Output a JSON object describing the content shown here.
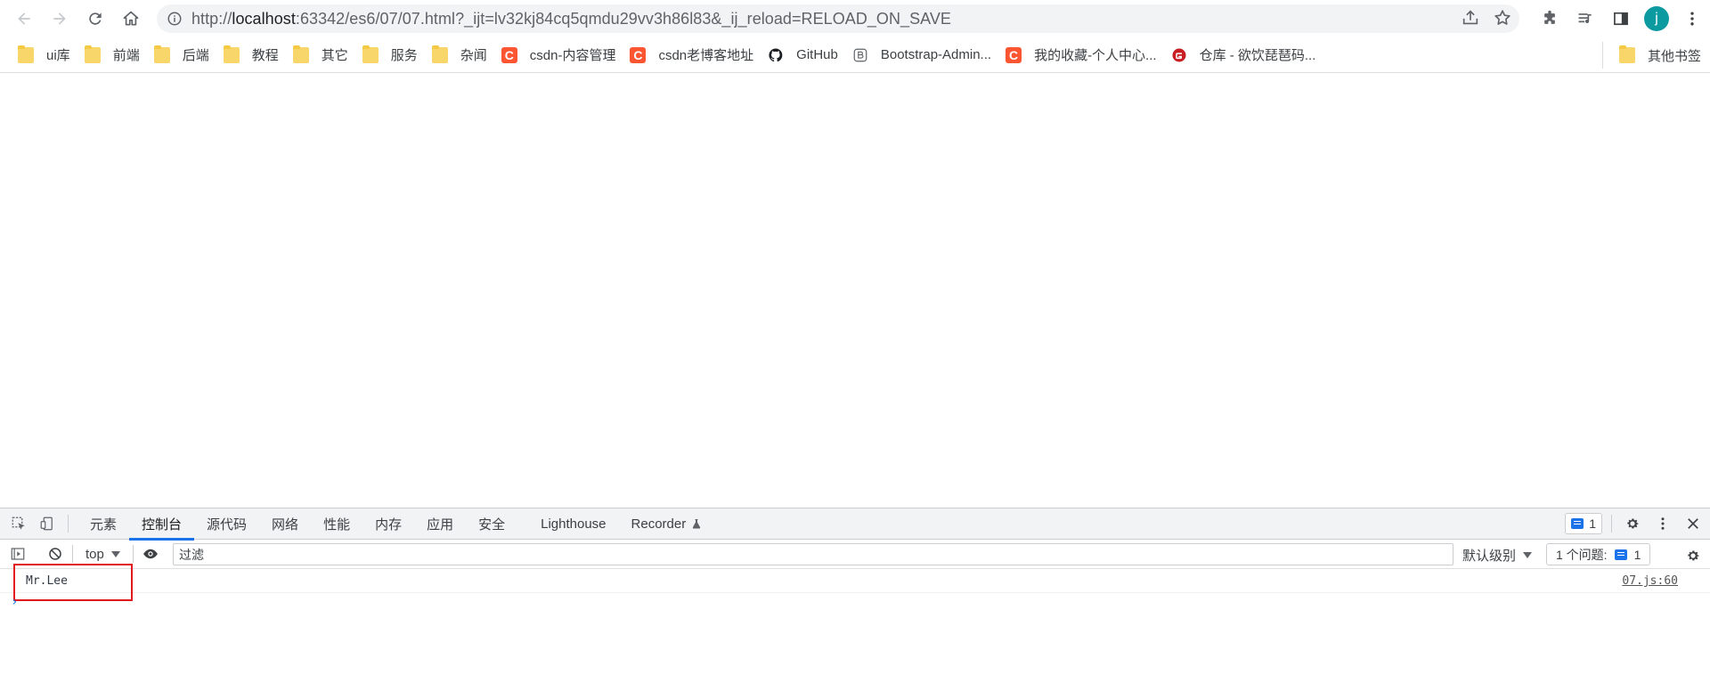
{
  "browser": {
    "url_prefix": "http://",
    "url_host": "localhost",
    "url_rest": ":63342/es6/07/07.html?_ijt=lv32kj84cq5qmdu29vv3h86l83&_ij_reload=RELOAD_ON_SAVE",
    "profile_initial": "j",
    "profile_color": "#0b9aa0"
  },
  "bookmarks": {
    "items": [
      {
        "label": "ui库",
        "icon": "folder-icon"
      },
      {
        "label": "前端",
        "icon": "folder-icon"
      },
      {
        "label": "后端",
        "icon": "folder-icon"
      },
      {
        "label": "教程",
        "icon": "folder-icon"
      },
      {
        "label": "其它",
        "icon": "folder-icon"
      },
      {
        "label": "服务",
        "icon": "folder-icon"
      },
      {
        "label": "杂闻",
        "icon": "folder-icon"
      },
      {
        "label": "csdn-内容管理",
        "icon": "csdn-icon"
      },
      {
        "label": "csdn老博客地址",
        "icon": "csdn-icon"
      },
      {
        "label": "GitHub",
        "icon": "github-icon"
      },
      {
        "label": "Bootstrap-Admin...",
        "icon": "bootstrap-icon"
      },
      {
        "label": "我的收藏-个人中心...",
        "icon": "csdn-icon"
      },
      {
        "label": "仓库 - 欲饮琵琶码...",
        "icon": "gitee-icon"
      }
    ],
    "other": "其他书签",
    "csdn_letter": "C",
    "csdn_color": "#fc5531",
    "folder_color": "#f9d66a"
  },
  "devtools": {
    "tabs": [
      "元素",
      "控制台",
      "源代码",
      "网络",
      "性能",
      "内存",
      "应用",
      "安全",
      "Lighthouse",
      "Recorder"
    ],
    "active_tab": "控制台",
    "issue_count": "1",
    "context": "top",
    "filter_placeholder": "过滤",
    "levels": "默认级别",
    "issues_label": "1 个问题:",
    "issues_count": "1",
    "accent": "#1a73e8"
  },
  "console": {
    "messages": [
      {
        "text": "Mr.Lee",
        "source": "07.js:60"
      }
    ],
    "prompt": "›",
    "highlight_color": "#e1191f"
  }
}
